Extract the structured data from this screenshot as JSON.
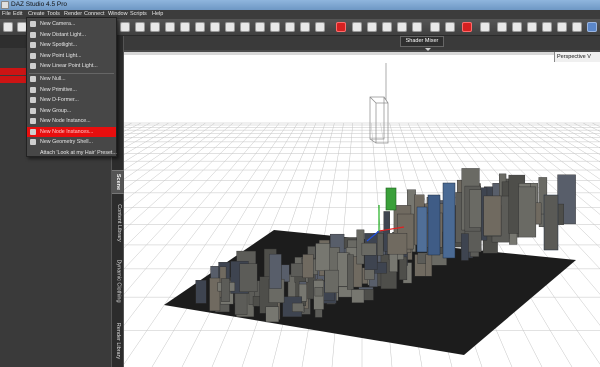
{
  "window": {
    "title": "DAZ Studio 4.5 Pro"
  },
  "menubar": {
    "items": [
      "File",
      "Edit",
      "Create",
      "Tools",
      "Render",
      "Connect",
      "Window",
      "Scripts",
      "Help"
    ]
  },
  "create_menu": {
    "items": [
      {
        "label": "New Camera...",
        "icon": "camera-icon"
      },
      {
        "label": "New Distant Light...",
        "icon": "distant-light-icon"
      },
      {
        "label": "New Spotlight...",
        "icon": "spotlight-icon"
      },
      {
        "label": "New Point Light...",
        "icon": "point-light-icon"
      },
      {
        "label": "New Linear Point Light...",
        "icon": "linear-point-light-icon"
      },
      {
        "label": "New Null...",
        "icon": "null-icon"
      },
      {
        "label": "New Primitive...",
        "icon": "primitive-icon"
      },
      {
        "label": "New D-Former...",
        "icon": "dformer-icon"
      },
      {
        "label": "New Group...",
        "icon": "group-icon"
      },
      {
        "label": "New Node Instance...",
        "icon": "node-instance-icon"
      },
      {
        "label": "New Node Instances...",
        "icon": "node-instances-icon",
        "highlighted": true
      },
      {
        "label": "New Geometry Shell...",
        "icon": "geometry-shell-icon"
      },
      {
        "label": "Attach 'Look at my Hair' Preset...",
        "icon": ""
      }
    ]
  },
  "side_tabs": [
    "Scene",
    "Content Library",
    "Dynamic Clothing",
    "Render Library"
  ],
  "shader_mixer": {
    "label": "Shader Mixer"
  },
  "viewport": {
    "camera_label": "Perspective V"
  },
  "colors": {
    "accent_red": "#e80e0e",
    "panel": "#3a3a3a",
    "viewport_bg": "#ffffff"
  }
}
